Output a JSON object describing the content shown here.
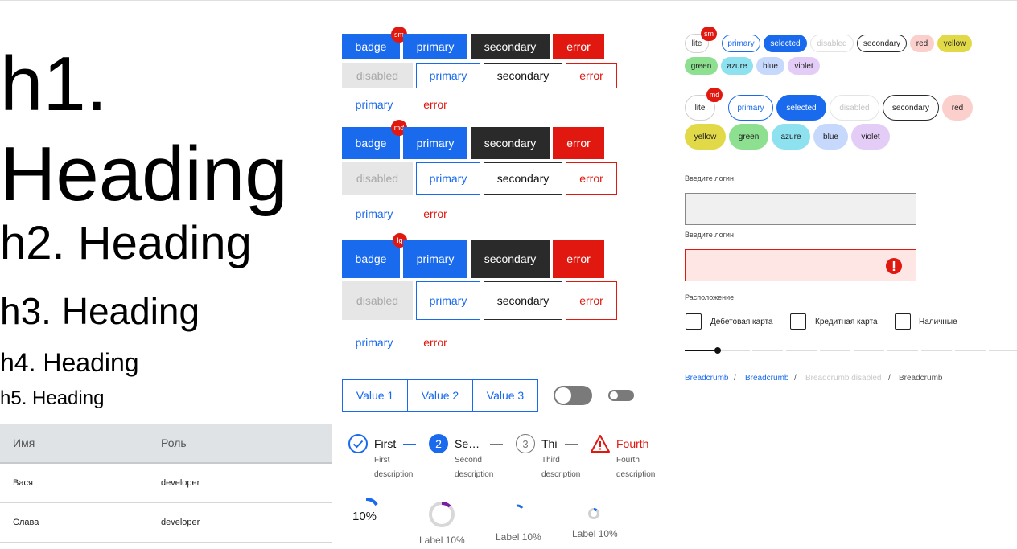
{
  "headings": {
    "h1": "h1. Heading",
    "h2": "h2. Heading",
    "h3": "h3. Heading",
    "h4": "h4. Heading",
    "h5": "h5. Heading"
  },
  "table": {
    "headers": [
      "Имя",
      "Роль"
    ],
    "rows": [
      [
        "Вася",
        "developer"
      ],
      [
        "Слава",
        "developer"
      ]
    ]
  },
  "buttons": {
    "badge": "badge",
    "primary": "primary",
    "secondary": "secondary",
    "error": "error",
    "disabled": "disabled",
    "sizes": [
      "sm",
      "md",
      "lg"
    ]
  },
  "segmented": [
    "Value 1",
    "Value 2",
    "Value 3"
  ],
  "stepper": [
    {
      "title": "First",
      "description": "First description",
      "state": "done"
    },
    {
      "title": "Se…",
      "description": "Second description",
      "number": "2",
      "state": "active"
    },
    {
      "title": "Thi",
      "description": "Third description",
      "number": "3",
      "state": "pending"
    },
    {
      "title": "Fourth",
      "description": "Fourth description",
      "state": "error"
    }
  ],
  "progress": {
    "first": "10%",
    "label": "Label 10%",
    "value": 0.1
  },
  "chips": {
    "badges": [
      "sm",
      "md"
    ],
    "labels": [
      "lite",
      "primary",
      "selected",
      "disabled",
      "secondary",
      "red",
      "yellow",
      "green",
      "azure",
      "blue",
      "violet"
    ]
  },
  "form": {
    "login_label": "Введите логин",
    "login_label_error": "Введите логин",
    "location_label": "Расположение",
    "checkboxes": [
      "Дебетовая карта",
      "Кредитная карта",
      "Наличные"
    ],
    "slider_value": 0.1
  },
  "breadcrumbs": [
    "Breadcrumb",
    "Breadcrumb",
    "Breadcrumb disabled",
    "Breadcrumb"
  ],
  "colors": {
    "accent": "#1a6aee",
    "error": "#e0180f",
    "dark": "#2a2a2a",
    "disabled": "#e6e6e6"
  }
}
